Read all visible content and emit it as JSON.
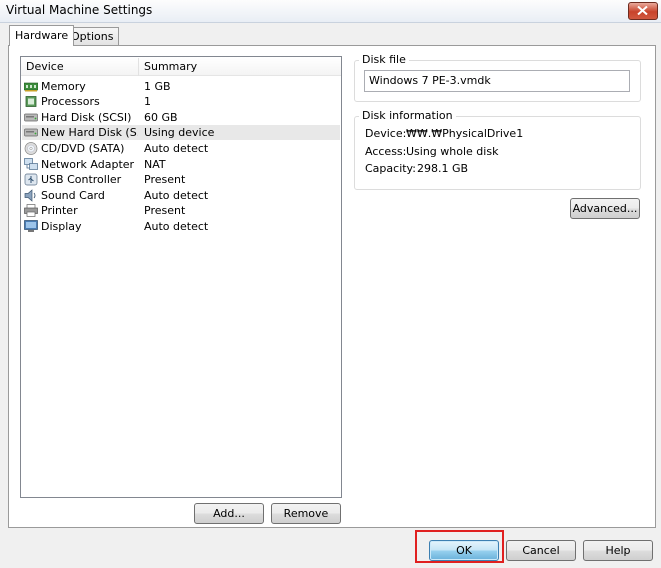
{
  "window": {
    "title": "Virtual Machine Settings",
    "close_icon": "close-icon"
  },
  "tabs": [
    {
      "label": "Hardware",
      "active": true
    },
    {
      "label": "Options",
      "active": false
    }
  ],
  "device_list": {
    "columns": [
      "Device",
      "Summary"
    ],
    "rows": [
      {
        "icon": "memory-icon",
        "device": "Memory",
        "summary": "1 GB",
        "selected": false
      },
      {
        "icon": "processor-icon",
        "device": "Processors",
        "summary": "1",
        "selected": false
      },
      {
        "icon": "hard-disk-icon",
        "device": "Hard Disk (SCSI)",
        "summary": "60 GB",
        "selected": false
      },
      {
        "icon": "hard-disk-icon",
        "device": "New Hard Disk (S...",
        "summary": "Using device",
        "selected": true
      },
      {
        "icon": "cd-dvd-icon",
        "device": "CD/DVD (SATA)",
        "summary": "Auto detect",
        "selected": false
      },
      {
        "icon": "network-adapter-icon",
        "device": "Network Adapter",
        "summary": "NAT",
        "selected": false
      },
      {
        "icon": "usb-icon",
        "device": "USB Controller",
        "summary": "Present",
        "selected": false
      },
      {
        "icon": "sound-card-icon",
        "device": "Sound Card",
        "summary": "Auto detect",
        "selected": false
      },
      {
        "icon": "printer-icon",
        "device": "Printer",
        "summary": "Present",
        "selected": false
      },
      {
        "icon": "display-icon",
        "device": "Display",
        "summary": "Auto detect",
        "selected": false
      }
    ]
  },
  "list_buttons": {
    "add": "Add...",
    "remove": "Remove"
  },
  "disk_file": {
    "label": "Disk file",
    "value": "Windows 7 PE-3.vmdk"
  },
  "disk_information": {
    "label": "Disk information",
    "device_label": "Device:",
    "device_value": "₩₩.₩PhysicalDrive1",
    "access_label": "Access:",
    "access_value": "Using whole disk",
    "capacity_label": "Capacity:",
    "capacity_value": "298.1 GB"
  },
  "advanced_button": "Advanced...",
  "footer_buttons": {
    "ok": "OK",
    "cancel": "Cancel",
    "help": "Help"
  },
  "colors": {
    "highlight": "#e02020",
    "selected_row": "#e8e8e8",
    "default_button": "#98d1ef"
  }
}
